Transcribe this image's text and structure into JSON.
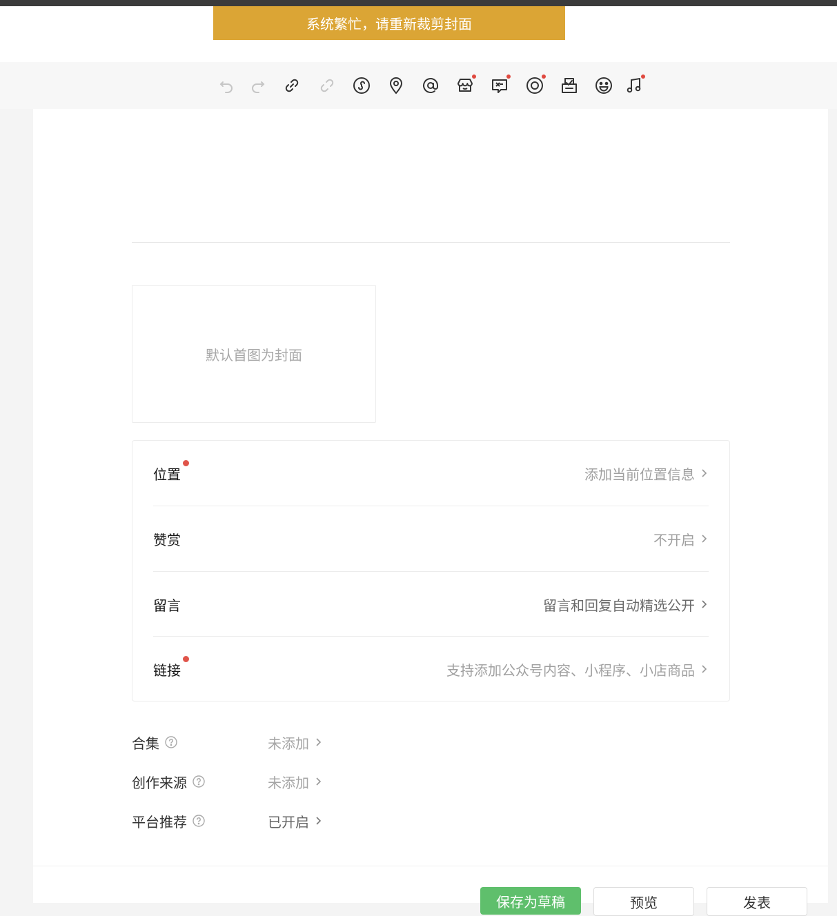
{
  "toast": {
    "message": "系统繁忙，请重新裁剪封面"
  },
  "toolbar": {
    "tools": [
      {
        "icon": "undo-icon"
      },
      {
        "icon": "redo-icon"
      },
      {
        "icon": "link-icon"
      },
      {
        "icon": "unlink-icon"
      },
      {
        "icon": "mini-program-icon"
      },
      {
        "icon": "location-icon"
      },
      {
        "icon": "mention-icon"
      },
      {
        "icon": "shop-icon",
        "badge": true
      },
      {
        "icon": "gift-icon",
        "badge": true
      },
      {
        "icon": "live-icon",
        "badge": true
      },
      {
        "icon": "vote-icon"
      },
      {
        "icon": "emoji-icon"
      },
      {
        "icon": "music-icon",
        "badge": true
      }
    ],
    "colors": {
      "active": "#333333",
      "disabled": "#c6c6c6",
      "badge": "#e0493f"
    }
  },
  "cover": {
    "placeholder": "默认首图为封面"
  },
  "settings": {
    "rows": [
      {
        "label": "位置",
        "value": "添加当前位置信息",
        "badge": true
      },
      {
        "label": "赞赏",
        "value": "不开启",
        "badge": false
      },
      {
        "label": "留言",
        "value": "留言和回复自动精选公开",
        "badge": false,
        "emphasis": true
      },
      {
        "label": "链接",
        "value": "支持添加公众号内容、小程序、小店商品",
        "badge": true
      }
    ]
  },
  "extras": [
    {
      "label": "合集",
      "value": "未添加"
    },
    {
      "label": "创作来源",
      "value": "未添加"
    },
    {
      "label": "平台推荐",
      "value": "已开启",
      "on": true
    }
  ],
  "footer": {
    "buttons": [
      {
        "label": "保存为草稿"
      },
      {
        "label": "预览"
      },
      {
        "label": "发表"
      }
    ]
  }
}
